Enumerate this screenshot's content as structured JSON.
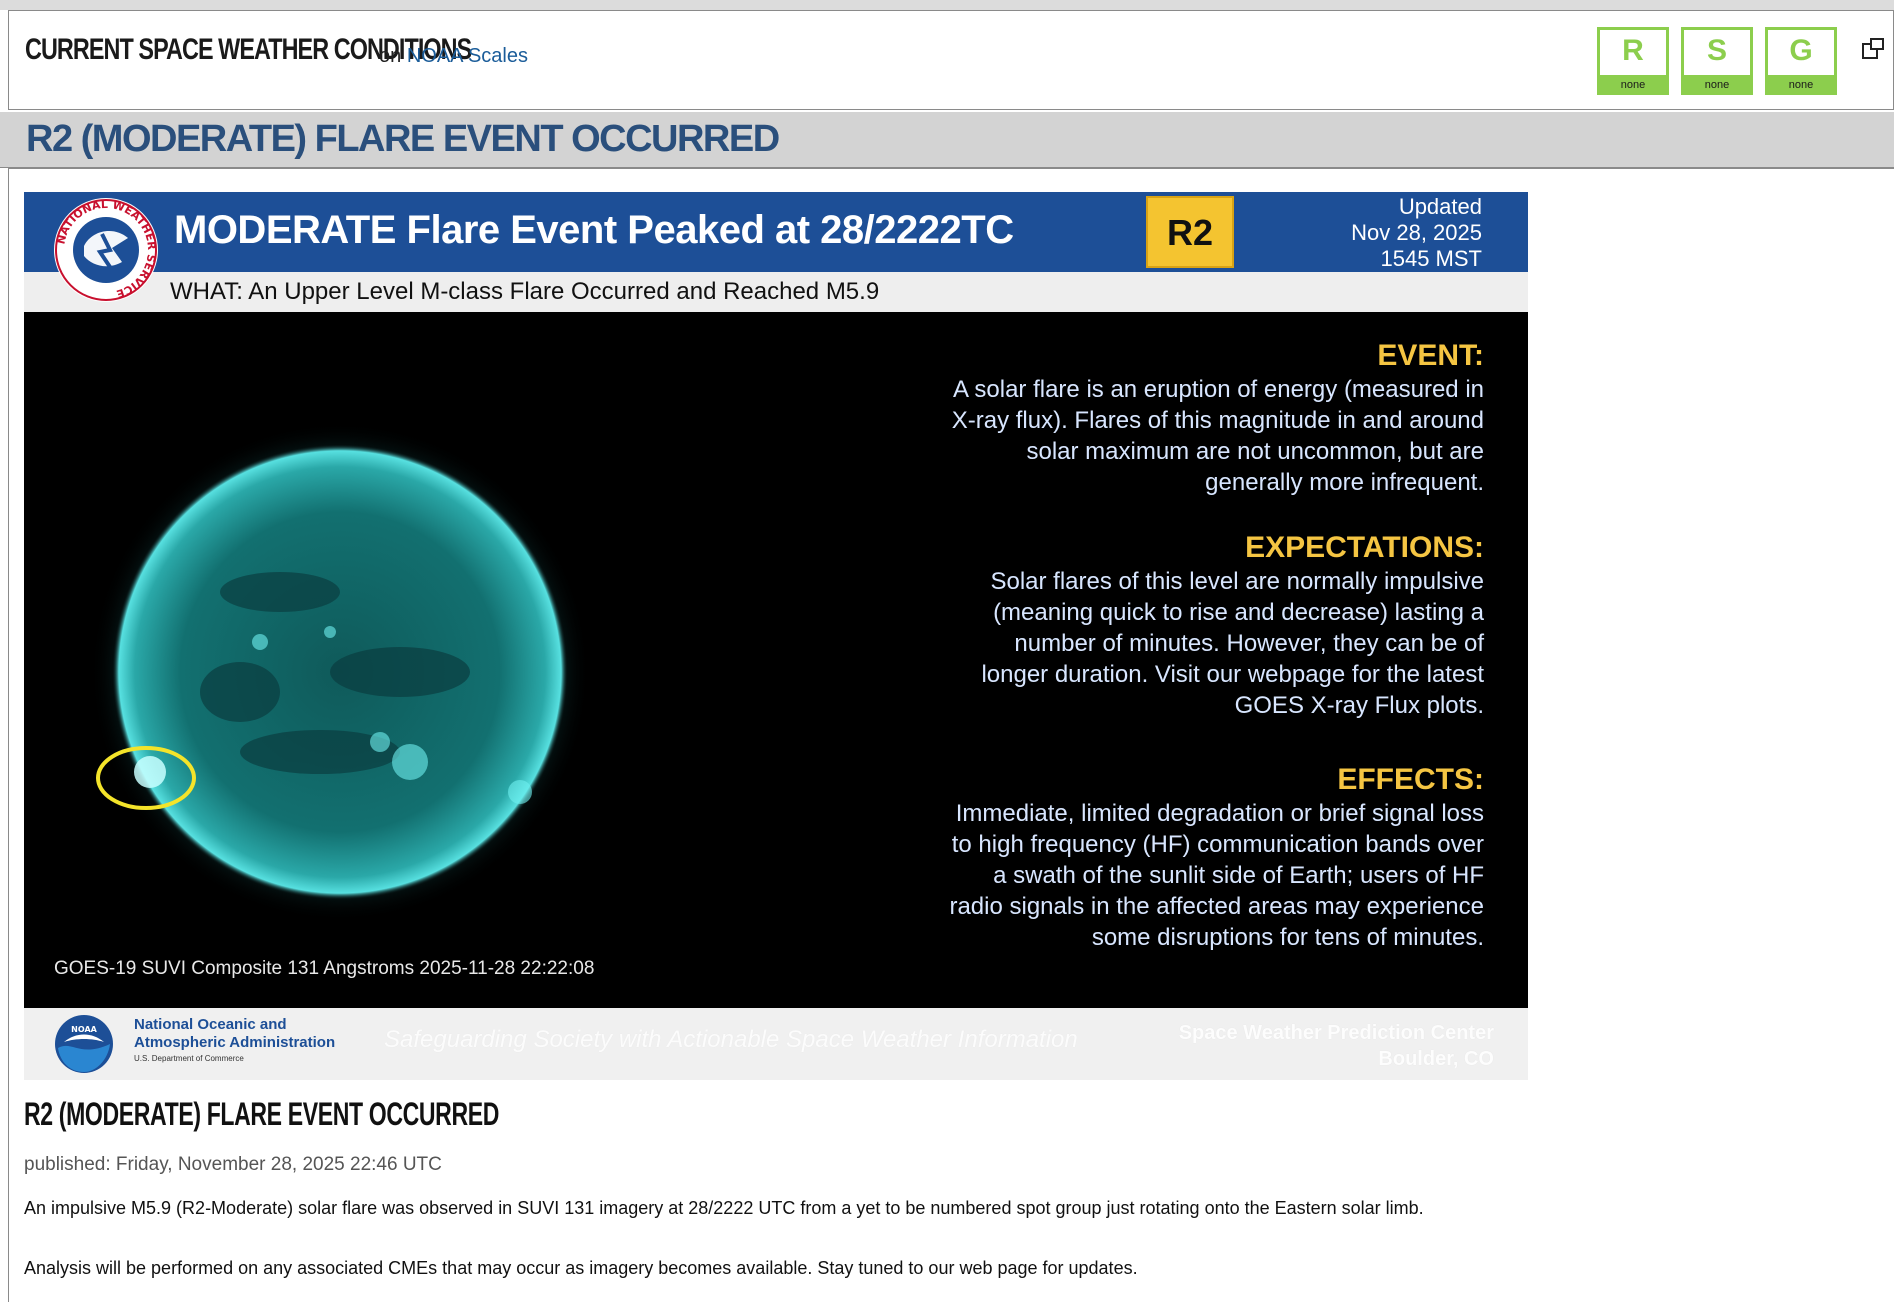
{
  "header": {
    "title": "CURRENT SPACE WEATHER CONDITIONS",
    "on_text": "on",
    "scales_link": "NOAA Scales"
  },
  "scales": [
    {
      "letter": "R",
      "value": "none"
    },
    {
      "letter": "S",
      "value": "none"
    },
    {
      "letter": "G",
      "value": "none"
    }
  ],
  "colors": {
    "scale_green": "#8cce4d",
    "banner_text": "#2a4f7c",
    "graphic_blue": "#1d4f97",
    "accent_yellow": "#f4c430"
  },
  "banner": {
    "title": "R2 (MODERATE) FLARE EVENT OCCURRED"
  },
  "graphic": {
    "header_title": "MODERATE Flare Event Peaked at 28/2222TC",
    "badge": "R2",
    "updated_line1": "Updated",
    "updated_line2": "Nov 28, 2025",
    "updated_line3": "1545 MST",
    "what": "WHAT: An Upper Level M-class Flare Occurred and Reached M5.9",
    "event_heading": "EVENT:",
    "event_lines": [
      "A solar flare is an eruption of energy (measured in",
      "X-ray flux). Flares of this magnitude in and around",
      "solar maximum are not uncommon, but are",
      "generally more infrequent."
    ],
    "expect_heading": "EXPECTATIONS:",
    "expect_lines": [
      "Solar flares of this level are normally impulsive",
      "(meaning quick to rise and decrease) lasting a",
      "number of minutes. However, they can be of",
      "longer duration. Visit our webpage for the latest",
      "GOES X-ray Flux plots."
    ],
    "effects_heading": "EFFECTS:",
    "effects_lines": [
      "Immediate, limited degradation or brief signal loss",
      "to high frequency (HF) communication bands over",
      "a swath of the sunlit side of Earth; users of HF",
      "radio signals in the affected areas may experience",
      "some disruptions for tens of minutes."
    ],
    "image_label": "GOES-19 SUVI Composite 131 Angstroms 2025-11-28 22:22:08",
    "noaa_line1": "National Oceanic and",
    "noaa_line2": "Atmospheric Administration",
    "noaa_sub": "U.S. Department of Commerce",
    "tagline": "Safeguarding Society with Actionable Space Weather Information",
    "swpc_line1": "Space Weather Prediction Center",
    "swpc_line2": "Boulder, CO",
    "nws_logo_text": "NATIONAL WEATHER SERVICE",
    "noaa_logo_text": "NOAA"
  },
  "article": {
    "title": "R2 (MODERATE) FLARE EVENT OCCURRED",
    "published": "published: Friday, November 28, 2025 22:46 UTC",
    "paragraph1": "An impulsive M5.9 (R2-Moderate) solar flare was observed in SUVI 131 imagery at 28/2222 UTC from a yet to be numbered spot group just rotating onto the Eastern solar limb.",
    "paragraph2": "Analysis will be performed on any associated CMEs that may occur as imagery becomes available. Stay tuned to our web page for updates."
  }
}
